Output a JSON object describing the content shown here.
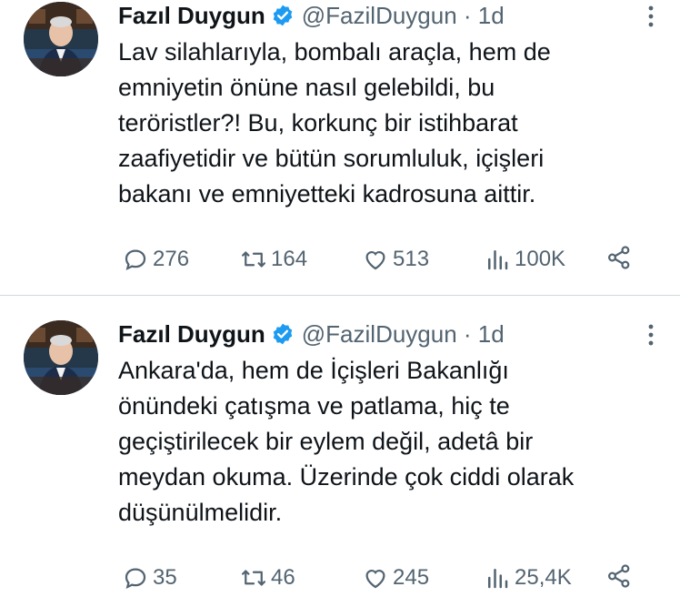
{
  "tweets": [
    {
      "author_name": "Fazıl Duygun",
      "handle_time": "@FazilDuygun · 1d",
      "text": "Lav silahlarıyla, bombalı araçla, hem de\nemniyetin önüne nasıl gelebildi, bu\nteröristler?! Bu, korkunç bir istihbarat\nzaafiyetidir ve bütün sorumluluk, içişleri\nbakanı ve emniyetteki kadrosuna aittir.",
      "replies": "276",
      "retweets": "164",
      "likes": "513",
      "views": "100K"
    },
    {
      "author_name": "Fazıl Duygun",
      "handle_time": "@FazilDuygun · 1d",
      "text": "Ankara'da, hem de İçişleri Bakanlığı\nönündeki çatışma ve patlama, hiç te\ngeçiştirilecek bir eylem değil, adetâ bir\nmeydan okuma. Üzerinde çok ciddi olarak\ndüşünülmelidir.",
      "replies": "35",
      "retweets": "46",
      "likes": "245",
      "views": "25,4K"
    }
  ],
  "icons": {
    "verified": "verified-badge-icon",
    "more": "more-vertical-icon",
    "reply": "reply-icon",
    "retweet": "retweet-icon",
    "like": "heart-icon",
    "views": "views-chart-icon",
    "share": "share-icon"
  },
  "colors": {
    "verified_blue": "#1d9bf0",
    "muted": "#536471",
    "text": "#0f1419"
  }
}
